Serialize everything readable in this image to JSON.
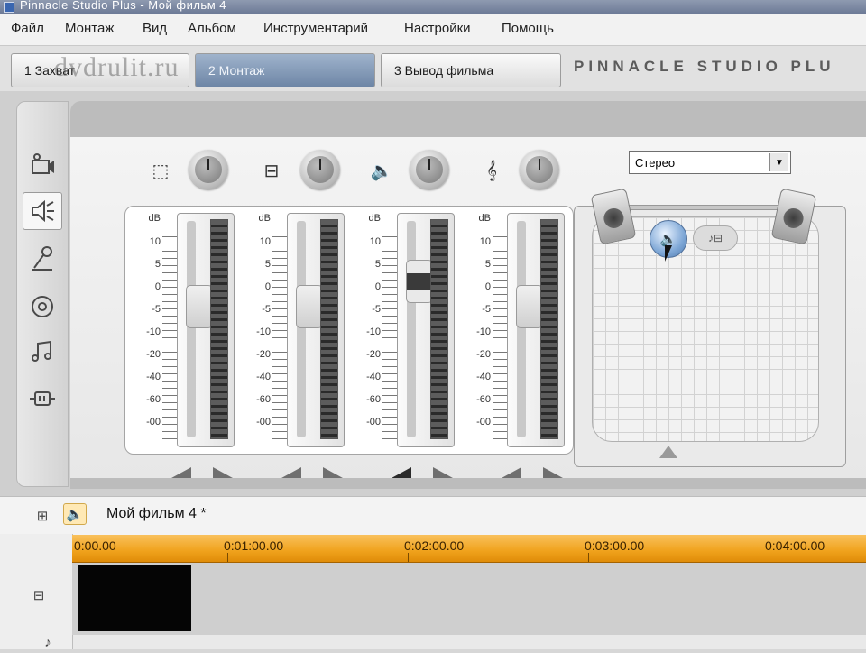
{
  "window": {
    "title": "Pinnacle Studio Plus - Мой фильм 4"
  },
  "menu": [
    "Файл",
    "Монтаж",
    "Вид",
    "Альбом",
    "Инструментарий",
    "Настройки",
    "Помощь"
  ],
  "tabs": [
    {
      "label": "1 Захват",
      "active": false
    },
    {
      "label": "2 Монтаж",
      "active": true
    },
    {
      "label": "3 Вывод фильма",
      "active": false
    }
  ],
  "watermark": "dvdrulit.ru",
  "brand": "PINNACLE STUDIO PLU",
  "left_tools": [
    {
      "icon": "video-effects-icon",
      "active": false
    },
    {
      "icon": "volume-mixer-icon",
      "active": true
    },
    {
      "icon": "voiceover-mic-icon",
      "active": false
    },
    {
      "icon": "cd-audio-icon",
      "active": false
    },
    {
      "icon": "music-note-icon",
      "active": false
    },
    {
      "icon": "audio-effects-icon",
      "active": false
    }
  ],
  "mixer": {
    "db_label": "dB",
    "scale": [
      "10",
      "5",
      "0",
      "-5",
      "-10",
      "-20",
      "-40",
      "-60",
      "-00"
    ],
    "channels": [
      {
        "icon": "original-audio-icon",
        "glyph": "⬚",
        "fader_level": 0.34
      },
      {
        "icon": "sound-effects-icon",
        "glyph": "⊟",
        "fader_level": 0.34
      },
      {
        "icon": "speaker-icon",
        "glyph": "🔈",
        "fader_level": 0.15
      },
      {
        "icon": "music-clef-icon",
        "glyph": "𝄞",
        "fader_level": 0.34
      }
    ]
  },
  "surround": {
    "mode": "Стерео",
    "puck_glyph": "🔈",
    "secondary_glyph": "♪⊟"
  },
  "timeline": {
    "title": "Мой фильм 4 *",
    "ruler": [
      "0:00.00",
      "0:01:00.00",
      "0:02:00.00",
      "0:03:00.00",
      "0:04:00.00"
    ]
  }
}
